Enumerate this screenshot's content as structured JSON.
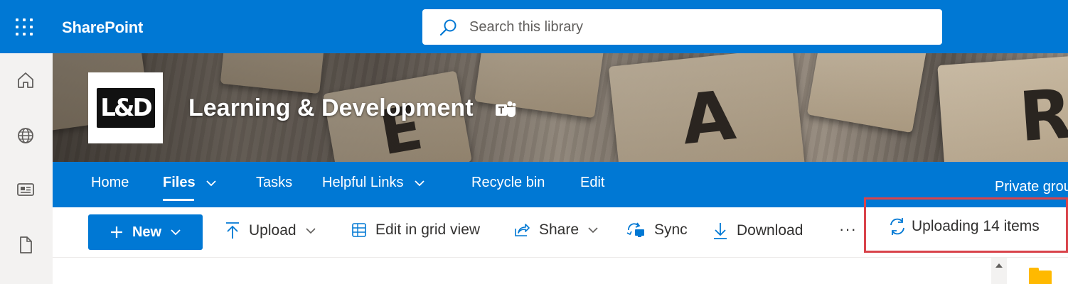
{
  "suite": {
    "app_name": "SharePoint",
    "search_placeholder": "Search this library"
  },
  "site": {
    "title": "Learning & Development",
    "logo_text": "L&D",
    "privacy": "Private group"
  },
  "nav": {
    "items": [
      {
        "label": "Home",
        "active": false,
        "has_dropdown": false
      },
      {
        "label": "Files",
        "active": true,
        "has_dropdown": true
      },
      {
        "label": "Tasks",
        "active": false,
        "has_dropdown": false
      },
      {
        "label": "Helpful Links",
        "active": false,
        "has_dropdown": true
      },
      {
        "label": "Recycle bin",
        "active": false,
        "has_dropdown": false
      },
      {
        "label": "Edit",
        "active": false,
        "has_dropdown": false
      }
    ]
  },
  "commands": {
    "new_label": "New",
    "upload_label": "Upload",
    "edit_grid_label": "Edit in grid view",
    "share_label": "Share",
    "sync_label": "Sync",
    "download_label": "Download",
    "more_label": "···",
    "upload_status": "Uploading 14 items"
  },
  "colors": {
    "brand": "#0078d4",
    "highlight_border": "#d9434a",
    "folder": "#ffb900"
  },
  "icons": [
    "waffle-icon",
    "search-icon",
    "home-icon",
    "globe-icon",
    "news-icon",
    "document-icon",
    "teams-icon",
    "chevron-down-icon",
    "plus-icon",
    "upload-icon",
    "grid-icon",
    "share-icon",
    "sync-icon",
    "download-icon",
    "refresh-icon",
    "folder-icon"
  ]
}
